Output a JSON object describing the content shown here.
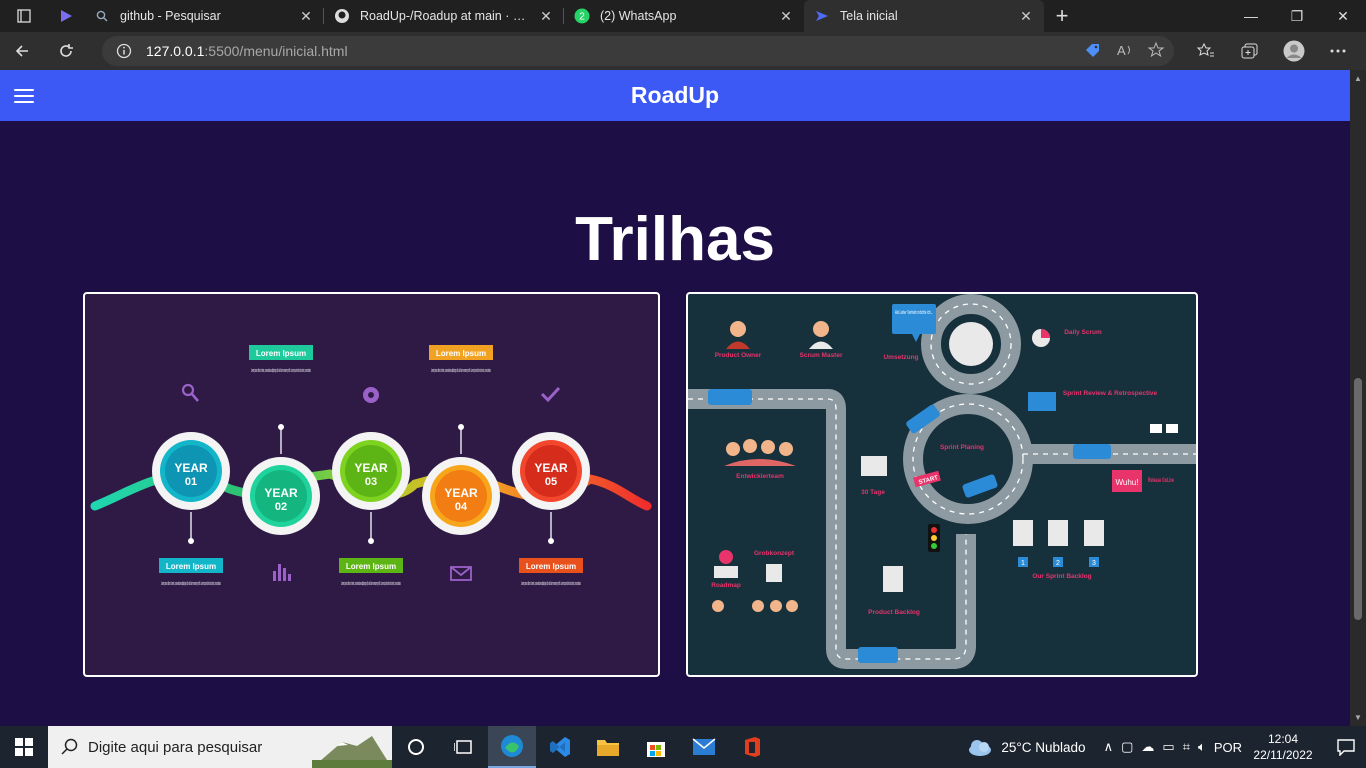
{
  "browser": {
    "tabs": [
      {
        "title": "github - Pesquisar",
        "icon": "search-icon"
      },
      {
        "title": "RoadUp-/Roadup at main · Patyh",
        "icon": "github-icon"
      },
      {
        "title": "(2) WhatsApp",
        "icon": "whatsapp-icon",
        "badge": "2"
      },
      {
        "title": "Tela inicial",
        "icon": "page-icon",
        "active": true
      }
    ],
    "url_host": "127.0.0.1",
    "url_path": ":5500/menu/inicial.html"
  },
  "page": {
    "brand": "RoadUp",
    "heading": "Trilhas",
    "colors": {
      "navbar": "#3c59f5",
      "background": "#1e0e46"
    }
  },
  "card1": {
    "top_labels": [
      "Lorem Ipsum",
      "Lorem Ipsum"
    ],
    "bottom_labels": [
      "Lorem Ipsum",
      "Lorem Ipsum",
      "Lorem Ipsum"
    ],
    "years": [
      {
        "word": "YEAR",
        "num": "01"
      },
      {
        "word": "YEAR",
        "num": "02"
      },
      {
        "word": "YEAR",
        "num": "03"
      },
      {
        "word": "YEAR",
        "num": "04"
      },
      {
        "word": "YEAR",
        "num": "05"
      }
    ],
    "body_text": "Lorem ipsum dolor sit amet, consectetuer adipiscing elit, sed diam nonummy nibh. Lorem ipsum dolor sit amet, consectetuer."
  },
  "card2": {
    "roles": [
      "Product Owner",
      "Scrum Master",
      "Umsetzung",
      "Daily Scrum",
      "Entwicklerteam",
      "Sprint Planing",
      "Sprint Review & Retrospective",
      "Roadmap",
      "Grobkonzept",
      "Product Backlog",
      "Our Sprint Backlog",
      "Release GoLive"
    ],
    "bubble": "Als Leiter Vertrieb möchte ich...",
    "start": "START",
    "wuhu": "Wuhu!",
    "days": "30 Tage",
    "backlog_nums": [
      "1",
      "2",
      "3"
    ]
  },
  "taskbar": {
    "search_placeholder": "Digite aqui para pesquisar",
    "weather": "25°C  Nublado",
    "language": "POR",
    "time": "12:04",
    "date": "22/11/2022"
  }
}
